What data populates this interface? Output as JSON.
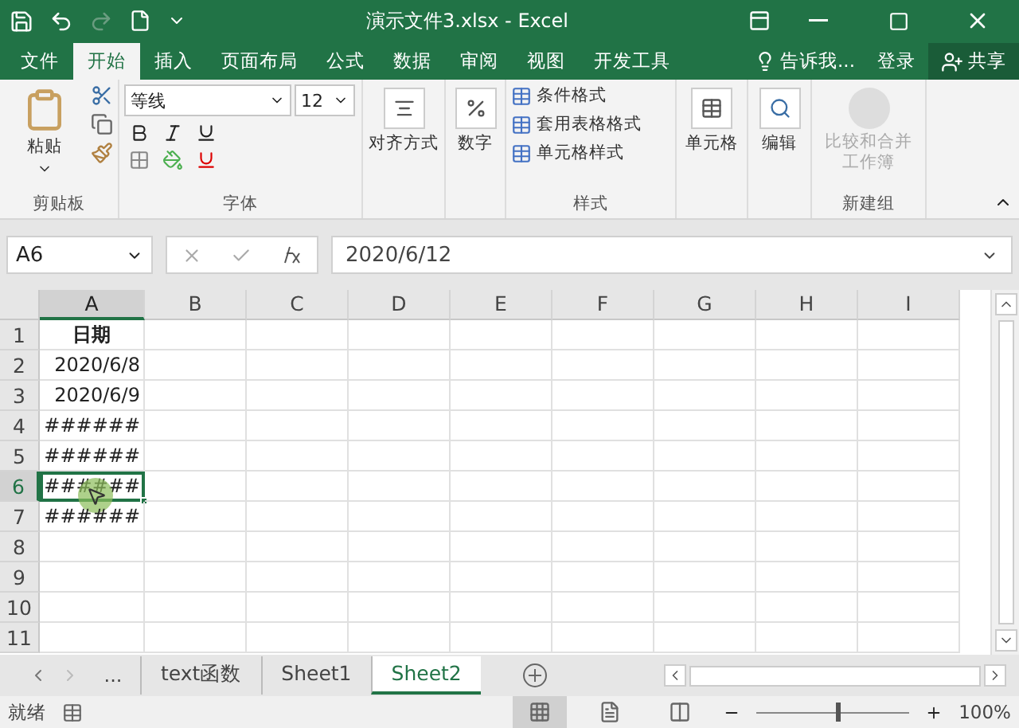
{
  "window": {
    "title": "演示文件3.xlsx - Excel"
  },
  "menu_tabs": [
    {
      "label": "文件",
      "selected": false
    },
    {
      "label": "开始",
      "selected": true
    },
    {
      "label": "插入",
      "selected": false
    },
    {
      "label": "页面布局",
      "selected": false
    },
    {
      "label": "公式",
      "selected": false
    },
    {
      "label": "数据",
      "selected": false
    },
    {
      "label": "审阅",
      "selected": false
    },
    {
      "label": "视图",
      "selected": false
    },
    {
      "label": "开发工具",
      "selected": false
    }
  ],
  "tell_me": "告诉我...",
  "sign_in": "登录",
  "share": "共享",
  "ribbon": {
    "clipboard": {
      "paste": "粘贴",
      "label": "剪贴板"
    },
    "font": {
      "name": "等线",
      "size": "12",
      "label": "字体"
    },
    "alignment": {
      "label": "对齐方式"
    },
    "number": {
      "label": "数字"
    },
    "styles": {
      "items": [
        "条件格式",
        "套用表格格式",
        "单元格样式"
      ],
      "label": "样式"
    },
    "cells": {
      "label": "单元格"
    },
    "editing": {
      "label": "编辑"
    },
    "new_group": {
      "button": "比较和合并工作簿",
      "disabled": true,
      "label": "新建组"
    }
  },
  "name_box": "A6",
  "formula": "2020/6/12",
  "columns": [
    {
      "label": "A",
      "selected": true
    },
    {
      "label": "B",
      "selected": false
    },
    {
      "label": "C",
      "selected": false
    },
    {
      "label": "D",
      "selected": false
    },
    {
      "label": "E",
      "selected": false
    },
    {
      "label": "F",
      "selected": false
    },
    {
      "label": "G",
      "selected": false
    },
    {
      "label": "H",
      "selected": false
    },
    {
      "label": "I",
      "selected": false
    }
  ],
  "rows": [
    {
      "header": "1",
      "a": "日期",
      "bold": true,
      "selected": false
    },
    {
      "header": "2",
      "a": "2020/6/8",
      "bold": false,
      "selected": false
    },
    {
      "header": "3",
      "a": "2020/6/9",
      "bold": false,
      "selected": false
    },
    {
      "header": "4",
      "a": "######",
      "bold": false,
      "selected": false
    },
    {
      "header": "5",
      "a": "######",
      "bold": false,
      "selected": false
    },
    {
      "header": "6",
      "a": "######",
      "bold": false,
      "selected": true
    },
    {
      "header": "7",
      "a": "######",
      "bold": false,
      "selected": false
    },
    {
      "header": "8",
      "selected": false
    },
    {
      "header": "9",
      "selected": false
    },
    {
      "header": "10",
      "selected": false
    },
    {
      "header": "11",
      "selected": false
    }
  ],
  "sheet_more": "...",
  "sheets": [
    {
      "label": "text函数",
      "selected": false
    },
    {
      "label": "Sheet1",
      "selected": false
    },
    {
      "label": "Sheet2",
      "selected": true
    }
  ],
  "status": "就绪",
  "views": [
    {
      "kind": "normal",
      "selected": true
    },
    {
      "kind": "layout",
      "selected": false
    },
    {
      "kind": "pagebreak",
      "selected": false
    }
  ],
  "zoom": {
    "level": 0.53,
    "reading": "100%"
  }
}
